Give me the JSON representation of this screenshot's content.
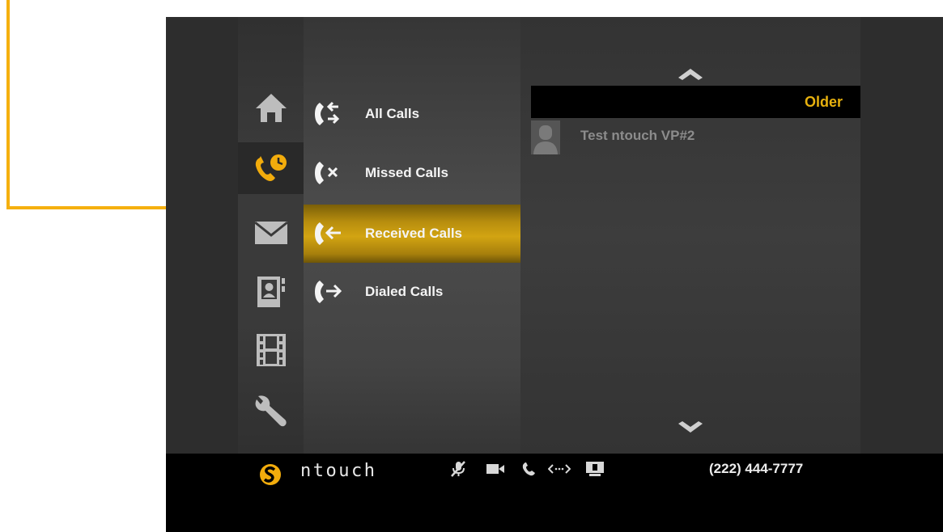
{
  "colors": {
    "accent": "#f5b00f",
    "older_text": "#e7b10e",
    "selected_bar": "#c09510"
  },
  "nav_rail": {
    "items": [
      {
        "name": "home",
        "icon": "home-icon",
        "active": false
      },
      {
        "name": "call-history",
        "icon": "call-history-icon",
        "active": true
      },
      {
        "name": "messages",
        "icon": "envelope-icon",
        "active": false
      },
      {
        "name": "contacts",
        "icon": "contacts-book-icon",
        "active": false
      },
      {
        "name": "videos",
        "icon": "film-strip-icon",
        "active": false
      },
      {
        "name": "settings",
        "icon": "wrench-icon",
        "active": false
      }
    ]
  },
  "submenu": {
    "items": [
      {
        "label": "All Calls",
        "icon": "all-calls-icon",
        "selected": false
      },
      {
        "label": "Missed Calls",
        "icon": "missed-calls-icon",
        "selected": false
      },
      {
        "label": "Received Calls",
        "icon": "received-calls-icon",
        "selected": true
      },
      {
        "label": "Dialed Calls",
        "icon": "dialed-calls-icon",
        "selected": false
      }
    ]
  },
  "list": {
    "group_header": "Older",
    "entries": [
      {
        "name": "Test ntouch VP#2",
        "avatar": "person-silhouette-icon"
      }
    ],
    "scroll_up_icon": "chevron-up-icon",
    "scroll_down_icon": "chevron-down-icon"
  },
  "status_bar": {
    "brand": "ntouch",
    "brand_icon": "sorenson-s-logo",
    "icons": [
      "mic-muted-icon",
      "video-camera-icon",
      "phone-icon",
      "network-arrows-icon",
      "monitor-icon"
    ],
    "phone_number": "(222) 444-7777"
  },
  "callout": {
    "type": "arrow",
    "points_to": "Received Calls"
  }
}
